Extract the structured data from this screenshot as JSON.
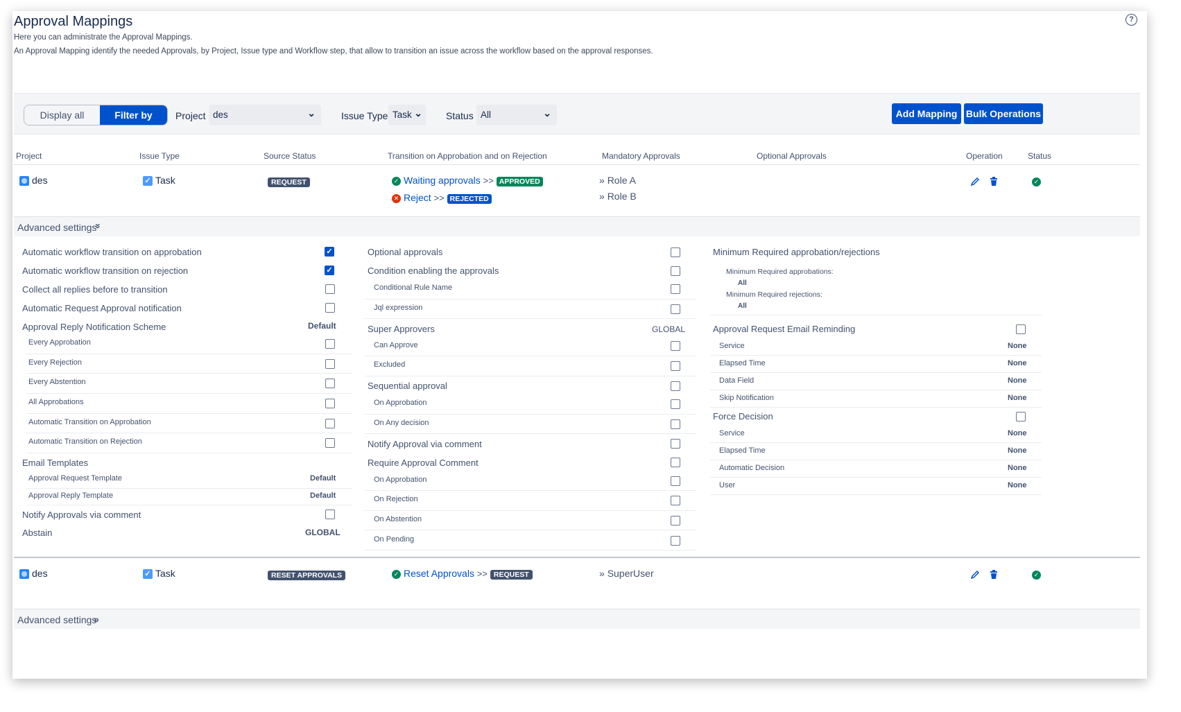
{
  "header": {
    "title": "Approval Mappings",
    "subtitle_1": "Here you can administrate the Approval Mappings.",
    "subtitle_2": "An Approval Mapping identify the needed Approvals, by Project, Issue type and Workflow step, that allow to transition an issue across the workflow based on the approval responses.",
    "help_glyph": "?"
  },
  "filter": {
    "display_all": "Display all",
    "filter_by": "Filter by",
    "project_label": "Project",
    "project_value": "des",
    "issue_type_label": "Issue Type",
    "issue_type_value": "Task",
    "status_label": "Status",
    "status_value": "All",
    "chevron": "⌄",
    "add_mapping": "Add Mapping",
    "bulk_operations": "Bulk Operations"
  },
  "table": {
    "columns": [
      "Project",
      "Issue Type",
      "Source Status",
      "Transition on Approbation and on Rejection",
      "Mandatory Approvals",
      "Optional Approvals",
      "Operation",
      "Status"
    ]
  },
  "rows": [
    {
      "project": "des",
      "issue_type": "Task",
      "source_status": "REQUEST",
      "transitions": [
        {
          "name": "Waiting approvals",
          "arrow": ">>",
          "target": "APPROVED"
        },
        {
          "name": "Reject",
          "arrow": ">>",
          "target": "REJECTED"
        }
      ],
      "mandatory": [
        "Role A",
        "Role B"
      ],
      "advanced_label": "Advanced settings"
    },
    {
      "project": "des",
      "issue_type": "Task",
      "source_status": "RESET APPROVALS",
      "transitions": [
        {
          "name": "Reset Approvals",
          "arrow": ">>",
          "target": "REQUEST"
        }
      ],
      "mandatory": [
        "SuperUser"
      ],
      "advanced_label": "Advanced settings"
    }
  ],
  "icons": {
    "project": "project-icon",
    "task": "task-checkbox-icon",
    "edit": "pencil-icon",
    "delete": "trash-icon",
    "status": "check-circle-icon"
  },
  "settings": {
    "col1": {
      "auto_approb": "Automatic workflow transition on approbation",
      "auto_reject": "Automatic workflow transition on rejection",
      "collect": "Collect all replies before to transition",
      "auto_req_notif": "Automatic Request Approval notification",
      "reply_scheme": "Approval Reply Notification Scheme",
      "reply_scheme_value": "Default",
      "every_approbation": "Every Approbation",
      "every_rejection": "Every Rejection",
      "every_abstention": "Every Abstention",
      "all_approbations": "All Approbations",
      "auto_trans_approb": "Automatic Transition on Approbation",
      "auto_trans_reject": "Automatic Transition on Rejection",
      "email_templates": "Email Templates",
      "req_template": "Approval Request Template",
      "req_template_value": "Default",
      "reply_template": "Approval Reply Template",
      "reply_template_value": "Default",
      "notify_comment": "Notify Approvals via comment",
      "abstain": "Abstain",
      "abstain_value": "GLOBAL"
    },
    "col2": {
      "optional": "Optional approvals",
      "condition": "Condition enabling the approvals",
      "cond_rule": "Conditional Rule Name",
      "jql": "Jql expression",
      "super": "Super Approvers",
      "super_value": "GLOBAL",
      "can_approve": "Can Approve",
      "excluded": "Excluded",
      "sequential": "Sequential approval",
      "on_approbation": "On Approbation",
      "on_any": "On Any decision",
      "notify_comment": "Notify Approval via comment",
      "require_comment": "Require Approval Comment",
      "rc_approbation": "On Approbation",
      "rc_rejection": "On Rejection",
      "rc_abstention": "On Abstention",
      "rc_pending": "On Pending"
    },
    "col3": {
      "min_required": "Minimum Required approbation/rejections",
      "min_approbations": "Minimum Required approbations:",
      "min_approbations_value": "All",
      "min_rejections": "Minimum Required rejections:",
      "min_rejections_value": "All",
      "email_reminding": "Approval Request Email Reminding",
      "service": "Service",
      "service_value": "None",
      "elapsed": "Elapsed Time",
      "elapsed_value": "None",
      "data_field": "Data Field",
      "data_field_value": "None",
      "skip": "Skip Notification",
      "skip_value": "None",
      "force": "Force Decision",
      "f_service": "Service",
      "f_service_value": "None",
      "f_elapsed": "Elapsed Time",
      "f_elapsed_value": "None",
      "f_auto": "Automatic Decision",
      "f_auto_value": "None",
      "f_user": "User",
      "f_user_value": "None"
    }
  },
  "glyphs": {
    "expand_down": "»",
    "expand_right": "»",
    "check": "✓",
    "cross": "✕"
  }
}
